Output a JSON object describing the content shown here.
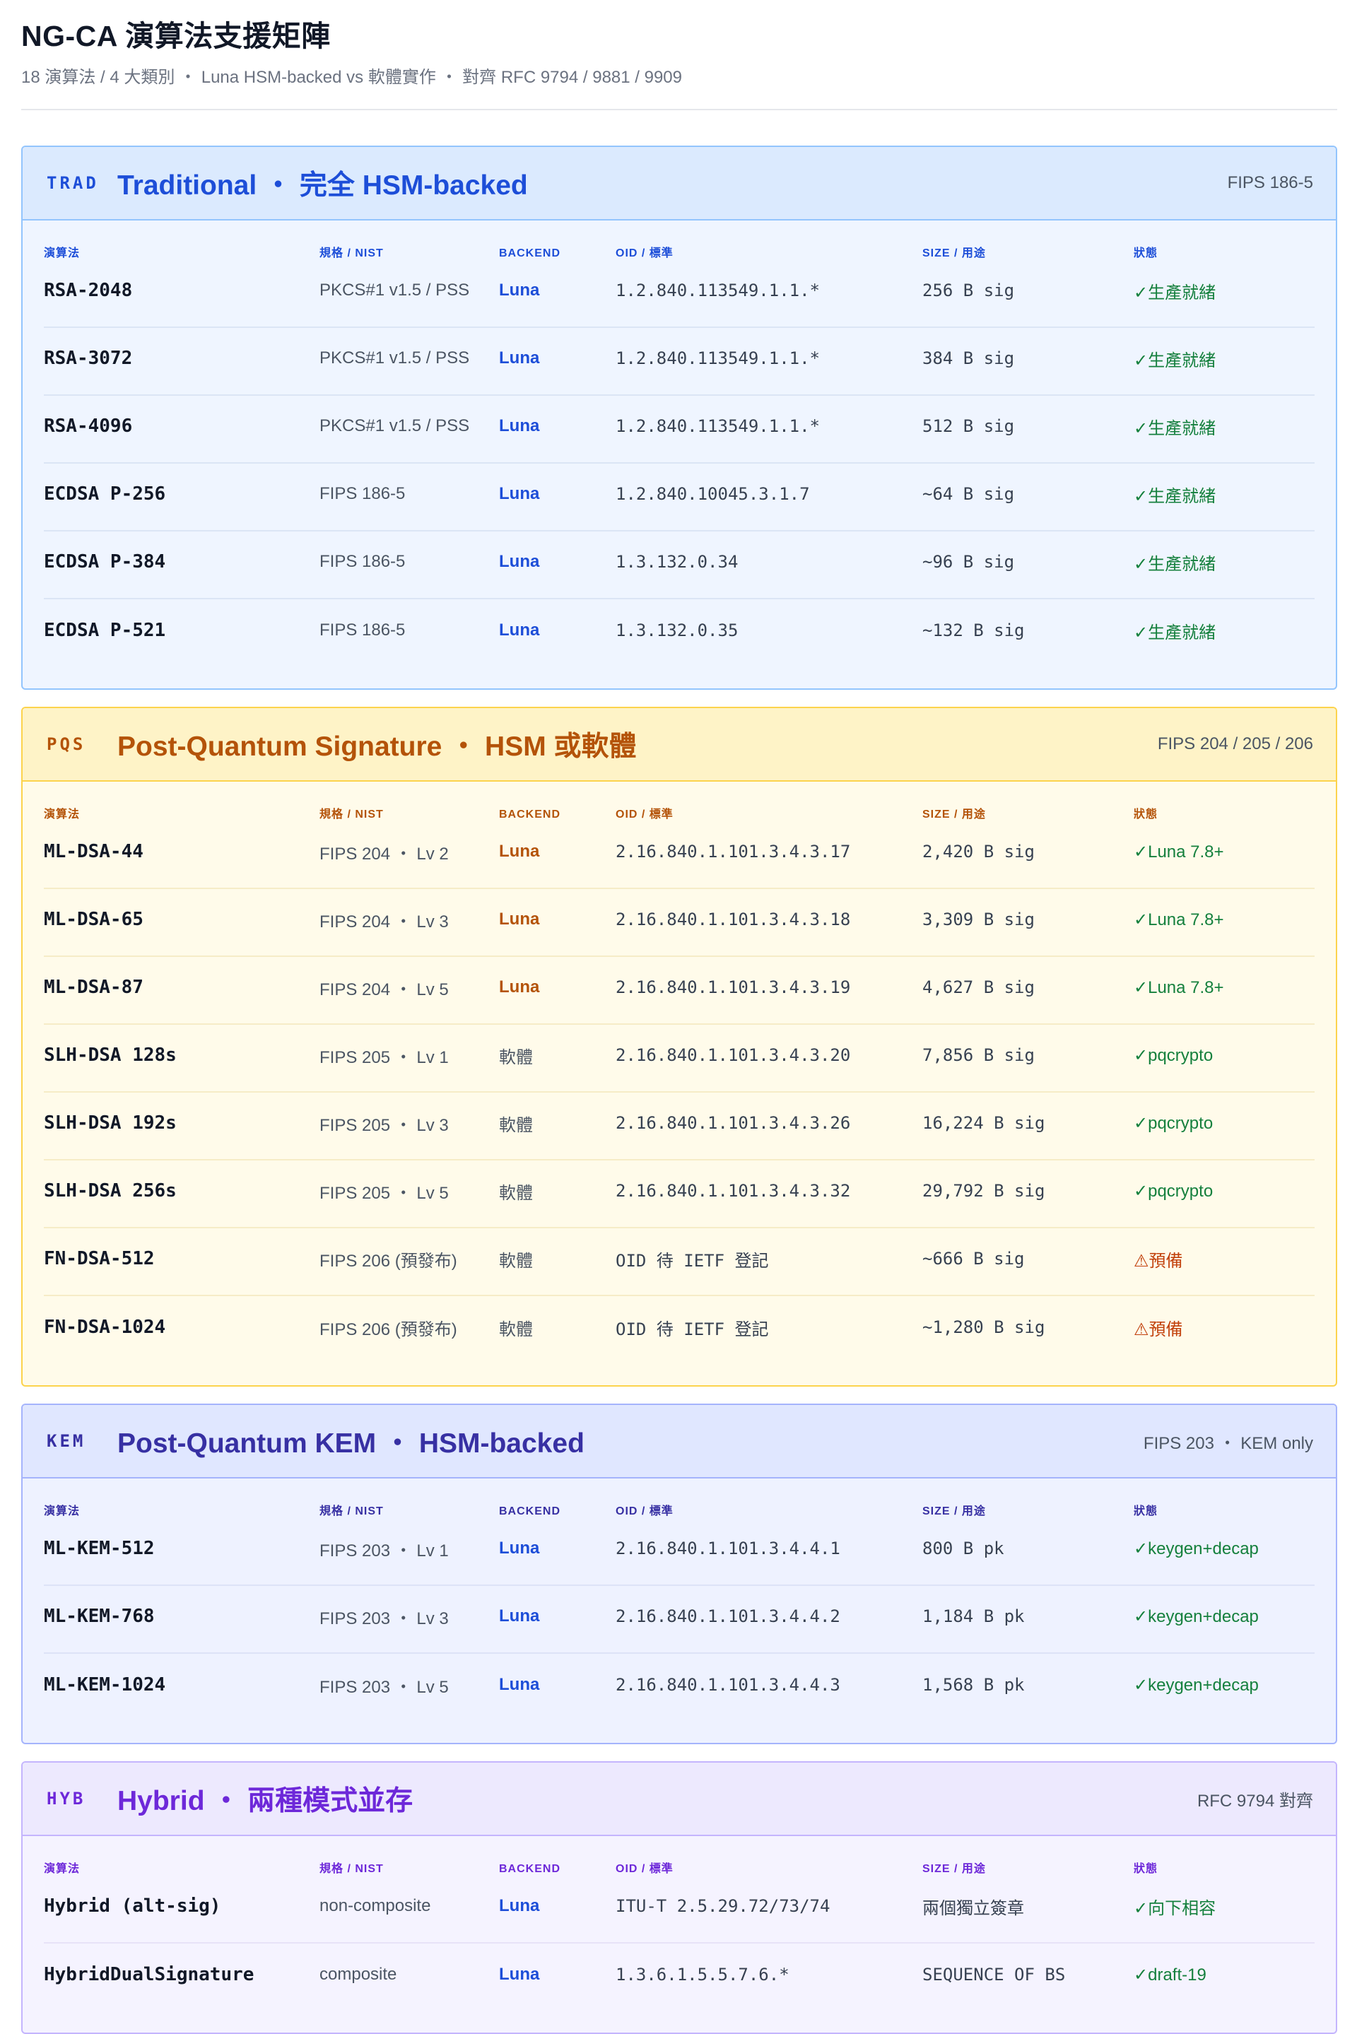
{
  "page": {
    "title": "NG-CA 演算法支援矩陣",
    "subtitle": "18 演算法 / 4 大類別 ・ Luna HSM-backed vs 軟體實作 ・ 對齊 RFC 9794 / 9881 / 9909"
  },
  "columns": [
    "演算法",
    "規格 / NIST",
    "BACKEND",
    "OID / 標準",
    "SIZE / 用途",
    "狀態"
  ],
  "colors": {
    "trad": "#1d4ed8",
    "pqs": "#b45309",
    "kem": "#3730a3",
    "hyb": "#6d28d9",
    "ok": "#15803d",
    "warn": "#c2410c"
  },
  "sections": [
    {
      "id": "trad",
      "tag": "TRAD",
      "title": "Traditional ・ 完全 HSM-backed",
      "ref": "FIPS 186-5",
      "rows": [
        {
          "algo": "RSA-2048",
          "spec": "PKCS#1 v1.5 / PSS",
          "backend": "Luna",
          "oid": "1.2.840.113549.1.1.*",
          "size": "256 B sig",
          "status": "✓生產就緒",
          "state": "ok"
        },
        {
          "algo": "RSA-3072",
          "spec": "PKCS#1 v1.5 / PSS",
          "backend": "Luna",
          "oid": "1.2.840.113549.1.1.*",
          "size": "384 B sig",
          "status": "✓生產就緒",
          "state": "ok"
        },
        {
          "algo": "RSA-4096",
          "spec": "PKCS#1 v1.5 / PSS",
          "backend": "Luna",
          "oid": "1.2.840.113549.1.1.*",
          "size": "512 B sig",
          "status": "✓生產就緒",
          "state": "ok"
        },
        {
          "algo": "ECDSA P-256",
          "spec": "FIPS 186-5",
          "backend": "Luna",
          "oid": "1.2.840.10045.3.1.7",
          "size": "~64 B sig",
          "status": "✓生產就緒",
          "state": "ok"
        },
        {
          "algo": "ECDSA P-384",
          "spec": "FIPS 186-5",
          "backend": "Luna",
          "oid": "1.3.132.0.34",
          "size": "~96 B sig",
          "status": "✓生產就緒",
          "state": "ok"
        },
        {
          "algo": "ECDSA P-521",
          "spec": "FIPS 186-5",
          "backend": "Luna",
          "oid": "1.3.132.0.35",
          "size": "~132 B sig",
          "status": "✓生產就緒",
          "state": "ok"
        }
      ]
    },
    {
      "id": "pqs",
      "tag": "PQS",
      "title": "Post-Quantum Signature ・ HSM 或軟體",
      "ref": "FIPS 204 / 205 / 206",
      "rows": [
        {
          "algo": "ML-DSA-44",
          "spec": "FIPS 204 ・ Lv 2",
          "backend": "Luna",
          "oid": "2.16.840.1.101.3.4.3.17",
          "size": "2,420 B sig",
          "status": "✓Luna 7.8+",
          "state": "ok"
        },
        {
          "algo": "ML-DSA-65",
          "spec": "FIPS 204 ・ Lv 3",
          "backend": "Luna",
          "oid": "2.16.840.1.101.3.4.3.18",
          "size": "3,309 B sig",
          "status": "✓Luna 7.8+",
          "state": "ok"
        },
        {
          "algo": "ML-DSA-87",
          "spec": "FIPS 204 ・ Lv 5",
          "backend": "Luna",
          "oid": "2.16.840.1.101.3.4.3.19",
          "size": "4,627 B sig",
          "status": "✓Luna 7.8+",
          "state": "ok"
        },
        {
          "algo": "SLH-DSA 128s",
          "spec": "FIPS 205 ・ Lv 1",
          "backend": "軟體",
          "oid": "2.16.840.1.101.3.4.3.20",
          "size": "7,856 B sig",
          "status": "✓pqcrypto",
          "state": "ok"
        },
        {
          "algo": "SLH-DSA 192s",
          "spec": "FIPS 205 ・ Lv 3",
          "backend": "軟體",
          "oid": "2.16.840.1.101.3.4.3.26",
          "size": "16,224 B sig",
          "status": "✓pqcrypto",
          "state": "ok"
        },
        {
          "algo": "SLH-DSA 256s",
          "spec": "FIPS 205 ・ Lv 5",
          "backend": "軟體",
          "oid": "2.16.840.1.101.3.4.3.32",
          "size": "29,792 B sig",
          "status": "✓pqcrypto",
          "state": "ok"
        },
        {
          "algo": "FN-DSA-512",
          "spec": "FIPS 206 (預發布)",
          "backend": "軟體",
          "oid": "OID 待 IETF 登記",
          "size": "~666 B sig",
          "status": "⚠預備",
          "state": "warn"
        },
        {
          "algo": "FN-DSA-1024",
          "spec": "FIPS 206 (預發布)",
          "backend": "軟體",
          "oid": "OID 待 IETF 登記",
          "size": "~1,280 B sig",
          "status": "⚠預備",
          "state": "warn"
        }
      ]
    },
    {
      "id": "kem",
      "tag": "KEM",
      "title": "Post-Quantum KEM ・ HSM-backed",
      "ref": "FIPS 203 ・ KEM only",
      "rows": [
        {
          "algo": "ML-KEM-512",
          "spec": "FIPS 203 ・ Lv 1",
          "backend": "Luna",
          "oid": "2.16.840.1.101.3.4.4.1",
          "size": "800 B pk",
          "status": "✓keygen+decap",
          "state": "ok"
        },
        {
          "algo": "ML-KEM-768",
          "spec": "FIPS 203 ・ Lv 3",
          "backend": "Luna",
          "oid": "2.16.840.1.101.3.4.4.2",
          "size": "1,184 B pk",
          "status": "✓keygen+decap",
          "state": "ok"
        },
        {
          "algo": "ML-KEM-1024",
          "spec": "FIPS 203 ・ Lv 5",
          "backend": "Luna",
          "oid": "2.16.840.1.101.3.4.4.3",
          "size": "1,568 B pk",
          "status": "✓keygen+decap",
          "state": "ok"
        }
      ]
    },
    {
      "id": "hyb",
      "tag": "HYB",
      "title": "Hybrid ・ 兩種模式並存",
      "ref": "RFC 9794 對齊",
      "rows": [
        {
          "algo": "Hybrid (alt-sig)",
          "spec": "non-composite",
          "backend": "Luna",
          "oid": "ITU-T 2.5.29.72/73/74",
          "size": "兩個獨立簽章",
          "status": "✓向下相容",
          "state": "ok"
        },
        {
          "algo": "HybridDualSignature",
          "spec": "composite",
          "backend": "Luna",
          "oid": "1.3.6.1.5.5.7.6.*",
          "size": "SEQUENCE OF BS",
          "status": "✓draft-19",
          "state": "ok"
        }
      ]
    }
  ]
}
